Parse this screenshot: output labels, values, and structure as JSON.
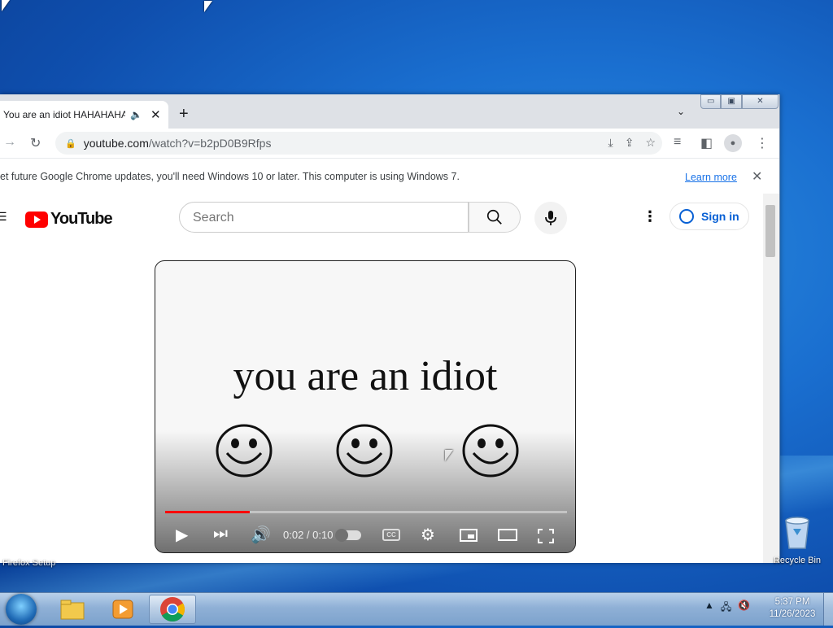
{
  "chrome": {
    "tab": {
      "title": "You are an idiot HAHAHAHA",
      "audio_icon": "speaker-icon",
      "close": "✕"
    },
    "new_tab": "+",
    "tab_search": "⌄",
    "window_controls": {
      "minimize": "▭",
      "maximize": "▣",
      "close": "✕"
    },
    "address": {
      "host": "youtube.com",
      "path": "/watch?v=b2pD0B9Rfps"
    },
    "infobar": {
      "message": "et future Google Chrome updates, you'll need Windows 10 or later. This computer is using Windows 7.",
      "learn_more": "Learn more",
      "close": "✕"
    }
  },
  "youtube": {
    "logo_text": "YouTube",
    "search_placeholder": "Search",
    "sign_in": "Sign in",
    "video": {
      "caption": "you are an idiot",
      "time": "0:02 / 0:10",
      "progress": 0.21,
      "cc": "CC"
    }
  },
  "desktop": {
    "recycle_bin": "Recycle Bin",
    "partial_icon_label": "Firefox Setup"
  },
  "taskbar": {
    "time": "5:37 PM",
    "date": "11/26/2023",
    "tray_arrow": "▲"
  },
  "colors": {
    "youtube_red": "#ff0000",
    "link_blue": "#1a73e8",
    "signin_blue": "#065fd4"
  }
}
